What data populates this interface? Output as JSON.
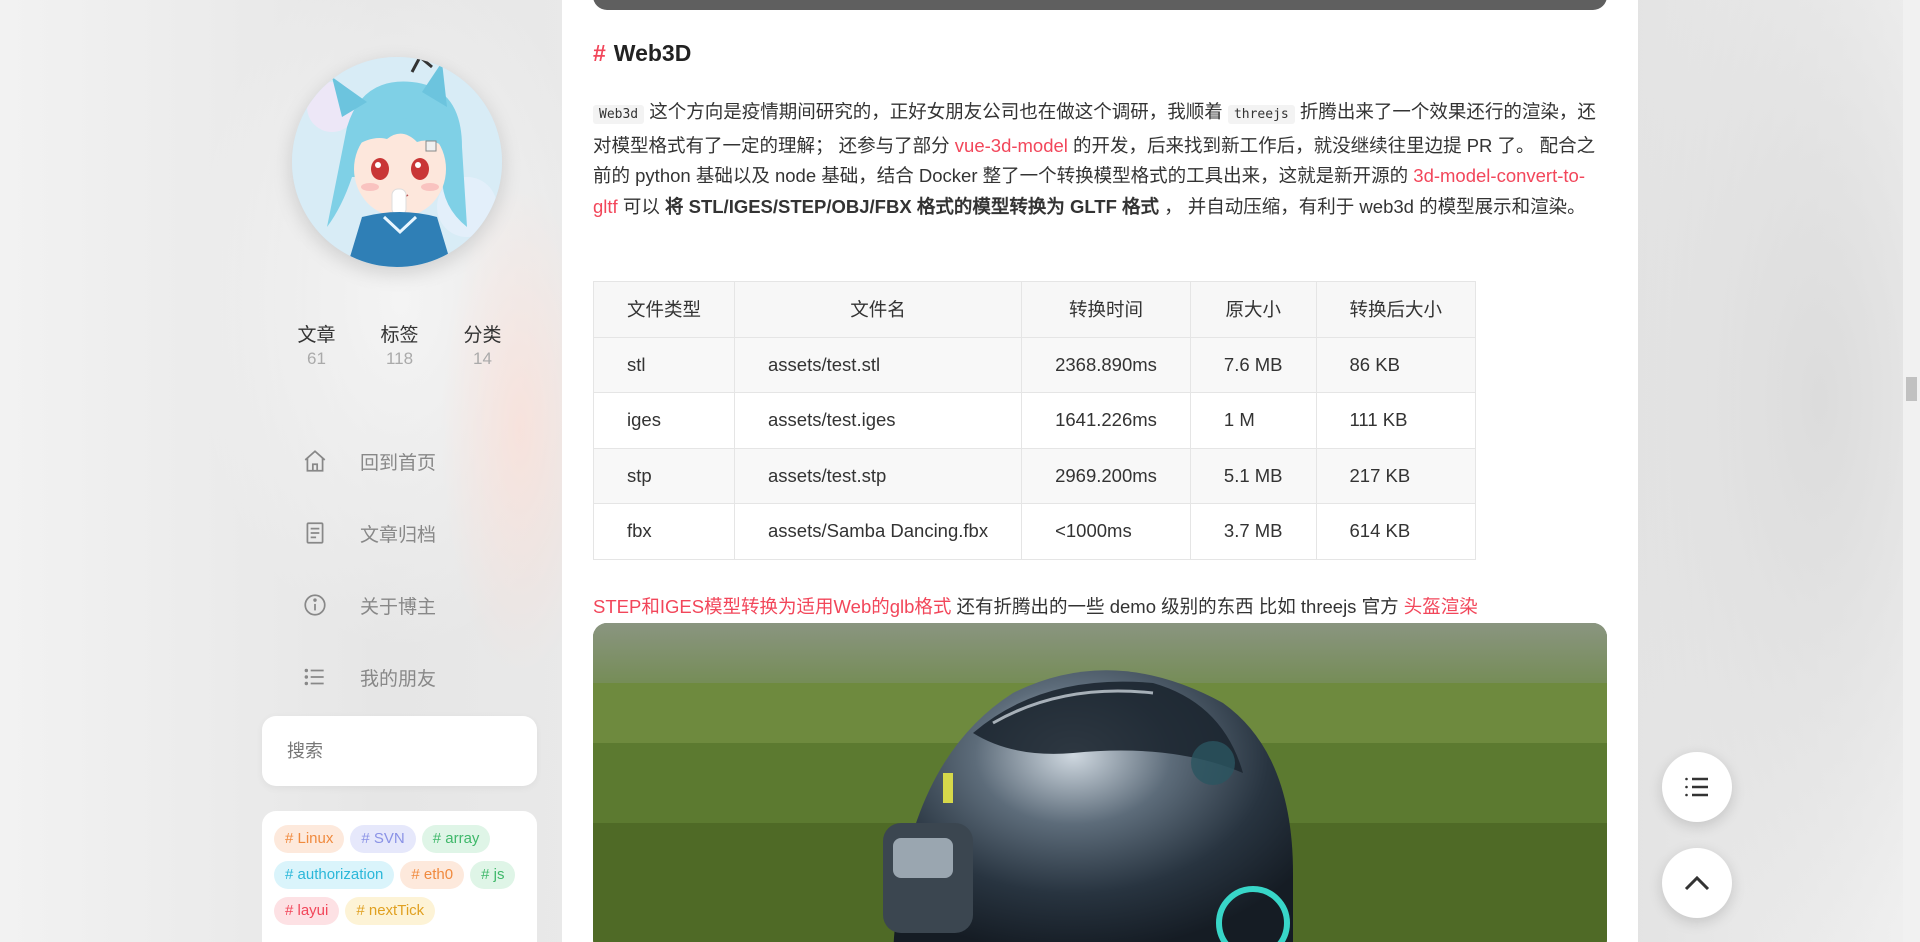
{
  "sidebar": {
    "stats": [
      {
        "label": "文章",
        "count": "61"
      },
      {
        "label": "标签",
        "count": "118"
      },
      {
        "label": "分类",
        "count": "14"
      }
    ],
    "menu": [
      {
        "label": "回到首页",
        "icon": "home-icon"
      },
      {
        "label": "文章归档",
        "icon": "archive-icon"
      },
      {
        "label": "关于博主",
        "icon": "info-icon"
      },
      {
        "label": "我的朋友",
        "icon": "list-icon"
      }
    ],
    "search_placeholder": "搜索",
    "tags": [
      {
        "label": "# Linux",
        "color": "#f08a3e",
        "bg": "#fde9dc"
      },
      {
        "label": "# SVN",
        "color": "#8a92e6",
        "bg": "#e6e8fb"
      },
      {
        "label": "# array",
        "color": "#3fb86a",
        "bg": "#dff5e7"
      },
      {
        "label": "# authorization",
        "color": "#2bb7d9",
        "bg": "#daf4fb"
      },
      {
        "label": "# eth0",
        "color": "#f08a3e",
        "bg": "#fde9dc"
      },
      {
        "label": "# js",
        "color": "#3fb86a",
        "bg": "#dff5e7"
      },
      {
        "label": "# layui",
        "color": "#f2465a",
        "bg": "#fde1e4"
      },
      {
        "label": "# nextTick",
        "color": "#e0a020",
        "bg": "#fdf3d6"
      }
    ]
  },
  "article": {
    "heading_hash": "#",
    "heading": "Web3D",
    "para": {
      "code1": "Web3d",
      "t1": " 这个方向是疫情期间研究的，正好女朋友公司也在做这个调研，我顺着 ",
      "code2": "threejs",
      "t2": " 折腾出来了一个效果还行的渲染，还对模型格式有了一定的理解； 还参与了部分 ",
      "link1": "vue-3d-model",
      "t3": " 的开发，后来找到新工作后，就没继续往里边提 PR 了。 配合之前的 python 基础以及 node 基础，结合 Docker 整了一个转换模型格式的工具出来，这就是新开源的 ",
      "link2": "3d-model-convert-to-gltf",
      "t4": " 可以 ",
      "bold": "将 STL/IGES/STEP/OBJ/FBX 格式的模型转换为 GLTF 格式",
      "t5": " ， 并自动压缩，有利于 web3d 的模型展示和渲染。"
    },
    "table": {
      "headers": [
        "文件类型",
        "文件名",
        "转换时间",
        "原大小",
        "转换后大小"
      ],
      "rows": [
        [
          "stl",
          "assets/test.stl",
          "2368.890ms",
          "7.6 MB",
          "86 KB"
        ],
        [
          "iges",
          "assets/test.iges",
          "1641.226ms",
          "1 M",
          "111 KB"
        ],
        [
          "stp",
          "assets/test.stp",
          "2969.200ms",
          "5.1 MB",
          "217 KB"
        ],
        [
          "fbx",
          "assets/Samba Dancing.fbx",
          "<1000ms",
          "3.7 MB",
          "614 KB"
        ]
      ]
    },
    "after": {
      "link1": "STEP和IGES模型转换为适用Web的glb格式",
      "text": " 还有折腾出的一些 demo 级别的东西 比如 threejs 官方 ",
      "link2": "头盔渲染"
    }
  },
  "fab": {
    "toc_icon": "toc-list-icon",
    "top_icon": "chevron-up-icon"
  },
  "colors": {
    "accent": "#f2465a"
  }
}
